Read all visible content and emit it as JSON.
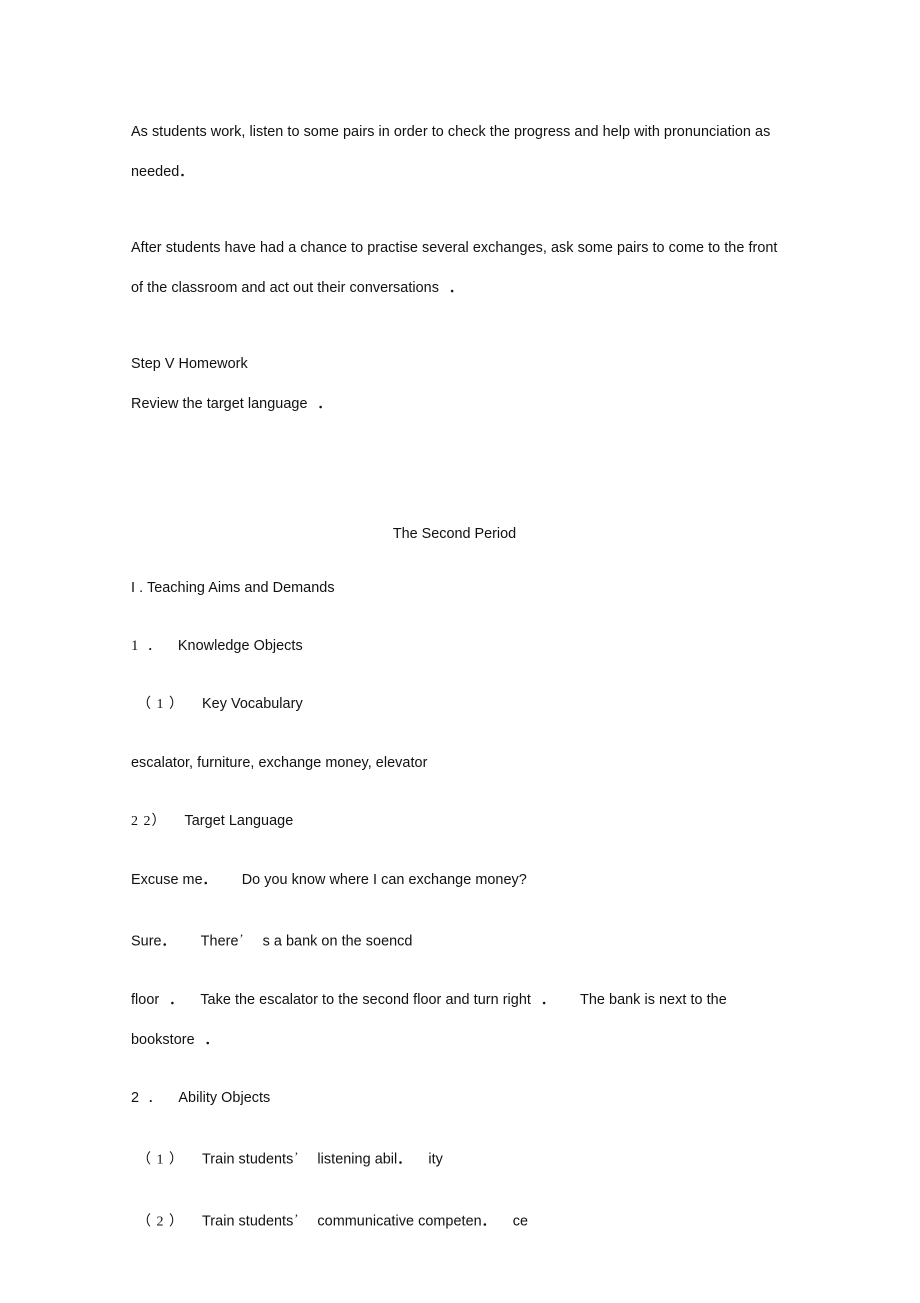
{
  "document": {
    "type": "lesson-plan-scan",
    "page_background": "#ffffff",
    "text_color": "#111111"
  },
  "body": {
    "paragraph_1_line_1": "As students work, listen to some pairs in order to check the progress and help with pronunciation as",
    "paragraph_1_line_2": "needed",
    "paragraph_2_line_1": "After students have had a chance to practise several exchanges, ask some pairs to come to the front",
    "paragraph_2_line_2": "of the classroom and act out their conversations",
    "step_v_heading": "Step V Homework",
    "step_v_body": "Review the target language"
  },
  "section_heading": {
    "title": "The Second Period"
  },
  "teaching_aims": {
    "roman_numeral": "I",
    "heading": "Teaching Aims and Demands",
    "item_1": {
      "number": "1",
      "dot": ".",
      "label": "Knowledge Objects"
    },
    "sub_1_1": {
      "marker": "（ 1 ）",
      "label": "Key Vocabulary",
      "content": "escalator, furniture, exchange money, elevator"
    },
    "sub_1_2": {
      "marker": "2 2）",
      "label": "Target Language",
      "line_1_a": "Excuse me",
      "line_1_b": "Do you know where I can exchange money?",
      "line_2_a": "Sure",
      "line_2_b": "There",
      "line_2_c": "s a bank on the soencd",
      "line_3_a": "floor",
      "line_3_b": "Take the escalator to the second floor and turn right",
      "line_3_c": "The bank is next to the bookstore",
      "line_3_d": "."
    },
    "item_2": {
      "number": "2",
      "dot": ".",
      "label": "Ability Objects"
    },
    "sub_2_1": {
      "marker": "（ 1 ）",
      "text_a": "Train students",
      "text_b": "listening abil",
      "text_c": "ity"
    },
    "sub_2_2": {
      "marker": "（ 2 ）",
      "text_a": "Train students",
      "text_b": "communicative competen",
      "text_c": "ce"
    }
  },
  "glyphs": {
    "fullwidth_period": "．",
    "apostrophe": "’"
  }
}
